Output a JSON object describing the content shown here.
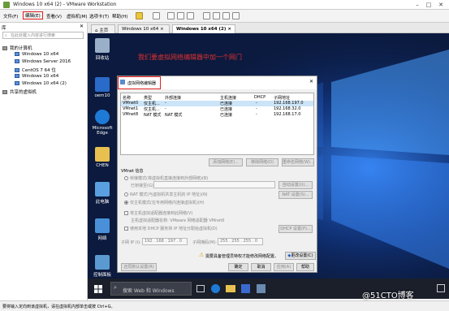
{
  "window": {
    "title": "Windows 10 x64 (2) - VMware Workstation"
  },
  "menu": [
    "文件(F)",
    "编辑(E)",
    "查看(V)",
    "虚拟机(M)",
    "选项卡(T)",
    "帮助(H)"
  ],
  "sidebar": {
    "header": "库",
    "search_placeholder": "在此处键入内容进行搜索",
    "root": "我的计算机",
    "items": [
      "Windows 10 x64",
      "Windows Server 2016",
      "CentOS 7 64 位",
      "Windows 10 x64",
      "Windows 10 x64 (2)"
    ],
    "shared": "共享的虚拟机"
  },
  "tabs": [
    "主页",
    "Windows 10 x64",
    "Windows 10 x64 (2)"
  ],
  "desktop": {
    "annotation": "我们要虚拟网络编辑器中加一个网门",
    "icons": [
      "回收站",
      "oem10",
      "Microsoft Edge",
      "CHEN",
      "此电脑",
      "网络",
      "控制面板"
    ]
  },
  "dialog": {
    "title": "虚拟网络编辑器",
    "columns": [
      "名称",
      "类型",
      "外部连接",
      "主机连接",
      "DHCP",
      "子网地址"
    ],
    "rows": [
      [
        "VMnet0",
        "仅主机...",
        "-",
        "已连接",
        "-",
        "192.168.197.0"
      ],
      [
        "VMnet1",
        "仅主机...",
        "-",
        "已连接",
        "-",
        "192.168.32.0"
      ],
      [
        "VMnet8",
        "NAT 模式",
        "NAT 模式",
        "已连接",
        "-",
        "192.168.17.0"
      ]
    ],
    "grid_buttons": [
      "添加网络(E)...",
      "移除网络(O)",
      "重命名网络(W)..."
    ],
    "info_title": "VMnet 信息",
    "bridge_option": "桥接模式(将虚拟机直接连接到外部网络)(B)",
    "bridge_to_label": "已桥接至(G):",
    "bridge_auto_btn": "自动设置(U)...",
    "nat_option": "NAT 模式(与虚拟机共享主机的 IP 地址)(N)",
    "nat_btn": "NAT 设置(S)...",
    "host_only_option": "仅主机模式(在专用网络内连接虚拟机)(H)",
    "connect_adapter": "将主机虚拟适配器连接到此网络(V)",
    "adapter_name": "主机虚拟适配器名称: VMware 网络适配器 VMnet0",
    "dhcp": "使用本地 DHCP 服务将 IP 地址分配给虚拟机(D)",
    "dhcp_btn": "DHCP 设置(P)...",
    "subnet_ip_label": "子网 IP (I):",
    "subnet_ip": "192 . 168 . 197 . 0",
    "mask_label": "子网掩码(M):",
    "mask": "255 . 255 . 255 . 0",
    "warning": "需要具备管理员特权才能修改网络配置。",
    "change_btn": "更改设置(C)",
    "bottom_buttons": [
      "还原默认设置(R)",
      "确定",
      "取消",
      "应用(A)",
      "帮助"
    ]
  },
  "taskbar": {
    "search": "搜索 Web 和 Windows"
  },
  "status": "要将输入定向到该虚拟机，请在虚拟机内部单击或按 Ctrl+G。",
  "watermark": "@51CTO博客",
  "colors": {
    "highlight": "#e02020",
    "annotation": "#e03030",
    "desktop": "#0b1a3e"
  }
}
